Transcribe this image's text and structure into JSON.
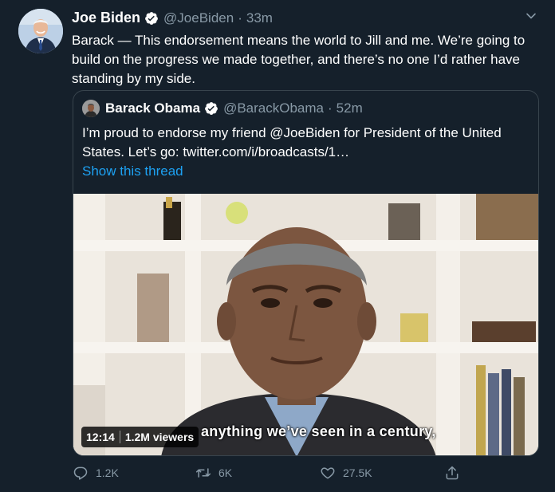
{
  "tweet": {
    "author_name": "Joe Biden",
    "author_handle": "@JoeBiden",
    "separator": "·",
    "time": "33m",
    "text": "Barack — This endorsement means the world to Jill and me. We’re going to build on the progress we made together, and there’s no one I’d rather have standing by my side."
  },
  "quoted": {
    "author_name": "Barack Obama",
    "author_handle": "@BarackObama",
    "separator": "·",
    "time": "52m",
    "text": "I’m proud to endorse my friend @JoeBiden for President of the United States. Let’s go: twitter.com/i/broadcasts/1…",
    "thread_link": "Show this thread",
    "video": {
      "duration": "12:14",
      "viewers": "1.2M viewers",
      "caption": "anything we’ve seen in a century,"
    }
  },
  "actions": {
    "replies": "1.2K",
    "retweets": "6K",
    "likes": "27.5K"
  },
  "colors": {
    "background": "#15202b",
    "secondary_text": "#8899a6",
    "link": "#1da1f2",
    "verified": "#ffffff"
  },
  "icons": {
    "verified": "verified-badge-icon",
    "chevron": "chevron-down-icon",
    "reply": "reply-icon",
    "retweet": "retweet-icon",
    "like": "heart-icon",
    "share": "share-icon"
  }
}
